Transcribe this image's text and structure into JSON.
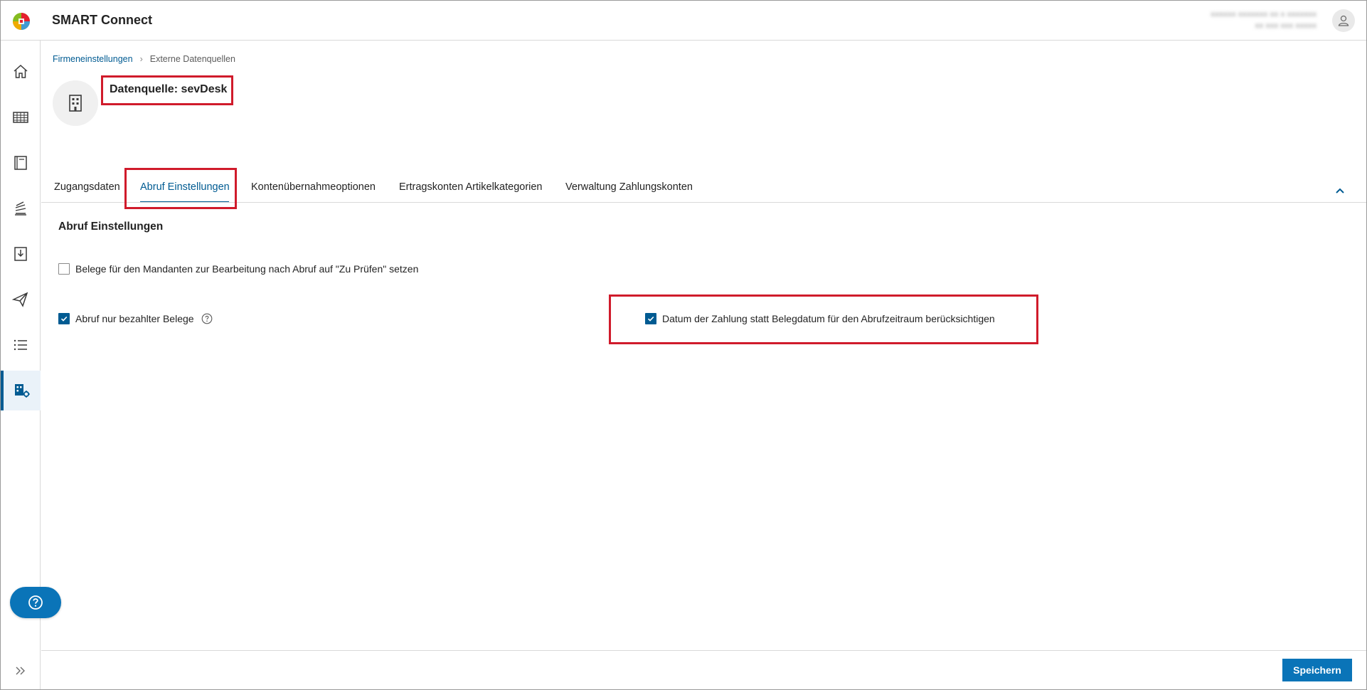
{
  "app": {
    "title": "SMART Connect",
    "user_line1": "xxxxxx xxxxxxx xx x xxxxxxx",
    "user_line2": "xx xxx xxx xxxxx"
  },
  "sidebar": {
    "items": [
      {
        "icon": "home-icon"
      },
      {
        "icon": "table-icon"
      },
      {
        "icon": "book-icon"
      },
      {
        "icon": "documents-icon"
      },
      {
        "icon": "download-icon"
      },
      {
        "icon": "send-icon"
      },
      {
        "icon": "list-icon"
      },
      {
        "icon": "company-settings-icon",
        "active": true
      }
    ]
  },
  "breadcrumb": {
    "items": [
      "Firmeneinstellungen",
      "Externe Datenquellen"
    ]
  },
  "page": {
    "title": "Datenquelle: sevDesk"
  },
  "tabs": [
    {
      "label": "Zugangsdaten"
    },
    {
      "label": "Abruf Einstellungen",
      "active": true
    },
    {
      "label": "Kontenübernahmeoptionen"
    },
    {
      "label": "Ertragskonten Artikelkategorien"
    },
    {
      "label": "Verwaltung Zahlungskonten"
    }
  ],
  "section": {
    "title": "Abruf Einstellungen",
    "checkboxes": [
      {
        "label": "Belege für den Mandanten zur Bearbeitung nach Abruf auf \"Zu Prüfen\" setzen",
        "checked": false
      },
      {
        "label": "Abruf nur bezahlter Belege",
        "checked": true,
        "has_info": true
      },
      {
        "label": "Datum der Zahlung statt Belegdatum für den Abrufzeitraum berücksichtigen",
        "checked": true
      }
    ]
  },
  "footer": {
    "save_label": "Speichern"
  },
  "colors": {
    "primary": "#005b92",
    "button": "#0a74b8",
    "highlight": "#d01b2b"
  }
}
